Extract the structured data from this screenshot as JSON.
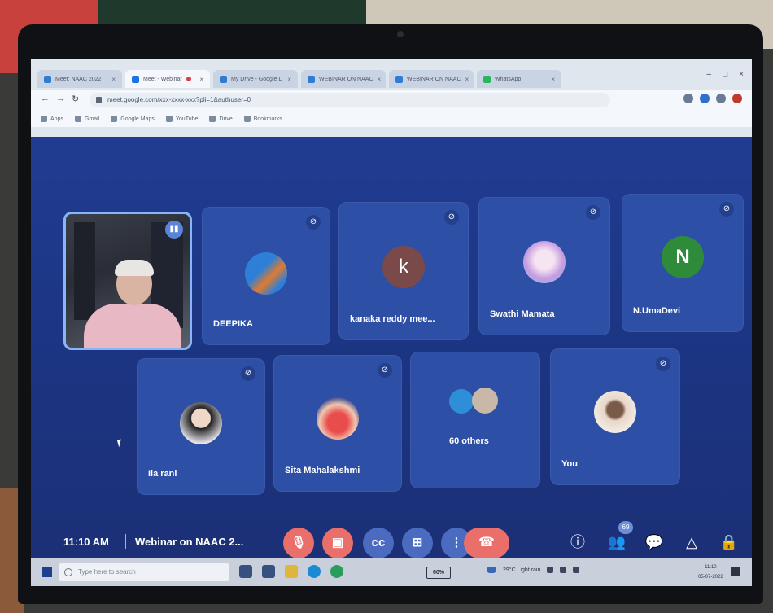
{
  "browser": {
    "tabs": [
      {
        "label": "Meet: NAAC 2022"
      },
      {
        "label": "Meet - Webinar",
        "active": true
      },
      {
        "label": "My Drive - Google D"
      },
      {
        "label": "WEBINAR ON NAAC"
      },
      {
        "label": "WEBINAR ON NAAC"
      },
      {
        "label": "WhatsApp"
      }
    ],
    "url": "meet.google.com/xxx-xxxx-xxx?pli=1&authuser=0",
    "bookmarks": [
      "Apps",
      "Gmail",
      "Google Maps",
      "YouTube",
      "Drive",
      "Bookmarks"
    ]
  },
  "meeting": {
    "participants": [
      {
        "name": "DEEPIKA",
        "avatar_letter": "",
        "avatar_color": "#2d7fd8"
      },
      {
        "name": "kanaka reddy mee...",
        "avatar_letter": "k",
        "avatar_color": "#7a4a4a"
      },
      {
        "name": "Swathi Mamata",
        "avatar_letter": "",
        "avatar_color": "#d9a8e0"
      },
      {
        "name": "N.UmaDevi",
        "avatar_letter": "N",
        "avatar_color": "#2e8b3a"
      },
      {
        "name": "Ila rani",
        "avatar_letter": "",
        "avatar_color": "#e6e6ea"
      },
      {
        "name": "Sita Mahalakshmi",
        "avatar_letter": "",
        "avatar_color": "#e84c4c"
      },
      {
        "name": "60 others",
        "avatar_letter": "",
        "avatar_color": "#2e8fd8"
      },
      {
        "name": "You",
        "avatar_letter": "",
        "avatar_color": "#e8d7c8"
      }
    ],
    "time": "11:10 AM",
    "title": "Webinar on NAAC 2...",
    "participants_count": "69"
  },
  "colors": {
    "meet_bg": "#1e3b8c",
    "tile_bg": "#2e4fa6",
    "control_red": "#ea6f6a",
    "control_gray": "#4a6bc0"
  },
  "taskbar": {
    "search_placeholder": "Type here to search",
    "battery": "60%",
    "weather": "29°C  Light rain",
    "clock_time": "11:10",
    "clock_date": "05-07-2022"
  }
}
